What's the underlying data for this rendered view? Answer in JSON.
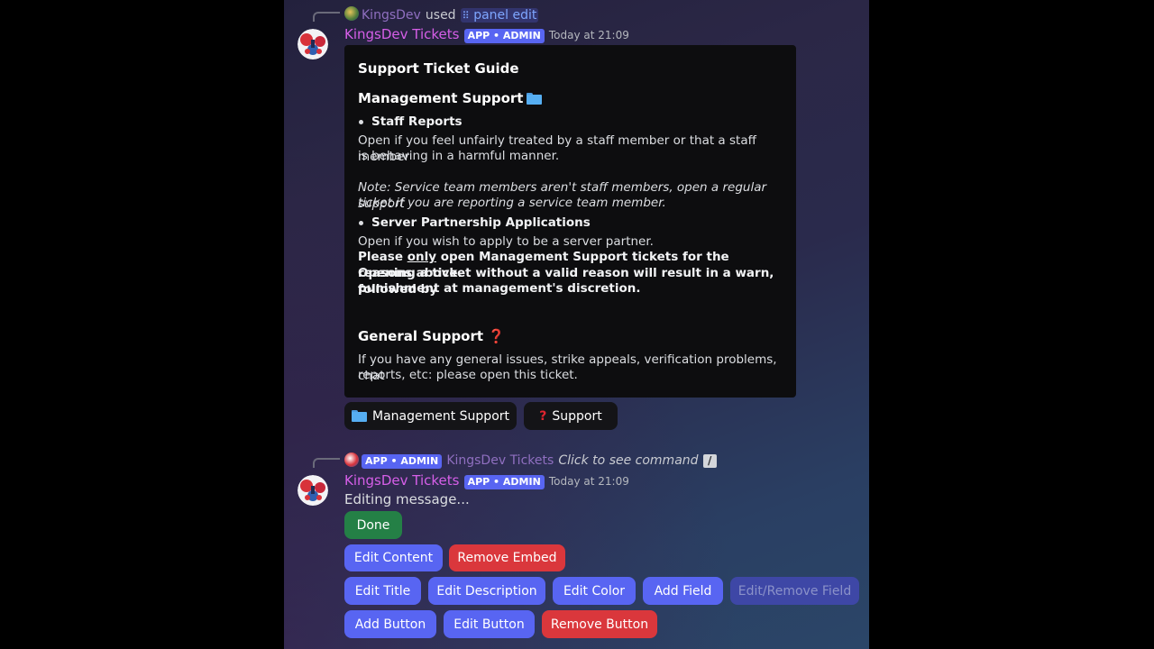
{
  "reply1": {
    "user": "KingsDev",
    "used_text": "used",
    "command": "panel edit",
    "command_icon": "slash-command-icon"
  },
  "message1": {
    "author": "KingsDev Tickets",
    "badge": "APP • ADMIN",
    "timestamp": "Today at 21:09",
    "embed": {
      "title": "Support Ticket Guide",
      "mgmt_heading": "Management Support",
      "mgmt_icon": "folder-icon",
      "bullet1": "Staff Reports",
      "staff_desc_1": "Open if you feel unfairly treated by a staff member or that a staff member",
      "staff_desc_2": "is behaving in a harmful manner.",
      "note_1": "Note: Service team members aren't staff members, open a regular support",
      "note_2": "ticket if you are reporting a service team member.",
      "bullet2": "Server Partnership Applications",
      "partner_desc": "Open if you wish to apply to be a server partner.",
      "warn_pre": "Please ",
      "warn_only": "only",
      "warn_post": " open Management Support tickets for the reasons above.",
      "warn_2": "Opening a ticket without a valid reason will result in a warn, followed by",
      "warn_3": "punishment at management's discretion.",
      "general_heading": "General Support",
      "general_icon": "question-mark-icon",
      "general_desc_1": "If you have any general issues, strike appeals, verification problems, chat",
      "general_desc_2": "reports, etc: please open this ticket."
    },
    "buttons": {
      "management": "Management Support",
      "support": "Support"
    }
  },
  "reply2": {
    "badge": "APP • ADMIN",
    "user": "KingsDev Tickets",
    "hint": "Click to see command"
  },
  "message2": {
    "author": "KingsDev Tickets",
    "badge": "APP • ADMIN",
    "timestamp": "Today at 21:09",
    "status": "Editing message...",
    "buttons": {
      "done": "Done",
      "edit_content": "Edit Content",
      "remove_embed": "Remove Embed",
      "edit_title": "Edit Title",
      "edit_description": "Edit Description",
      "edit_color": "Edit Color",
      "add_field": "Add Field",
      "edit_remove_field": "Edit/Remove Field",
      "add_button": "Add Button",
      "edit_button": "Edit Button",
      "remove_button": "Remove Button"
    }
  },
  "colors": {
    "blurple": "#5865f2",
    "danger": "#da373c",
    "success": "#248046",
    "author": "#d65fe8"
  }
}
